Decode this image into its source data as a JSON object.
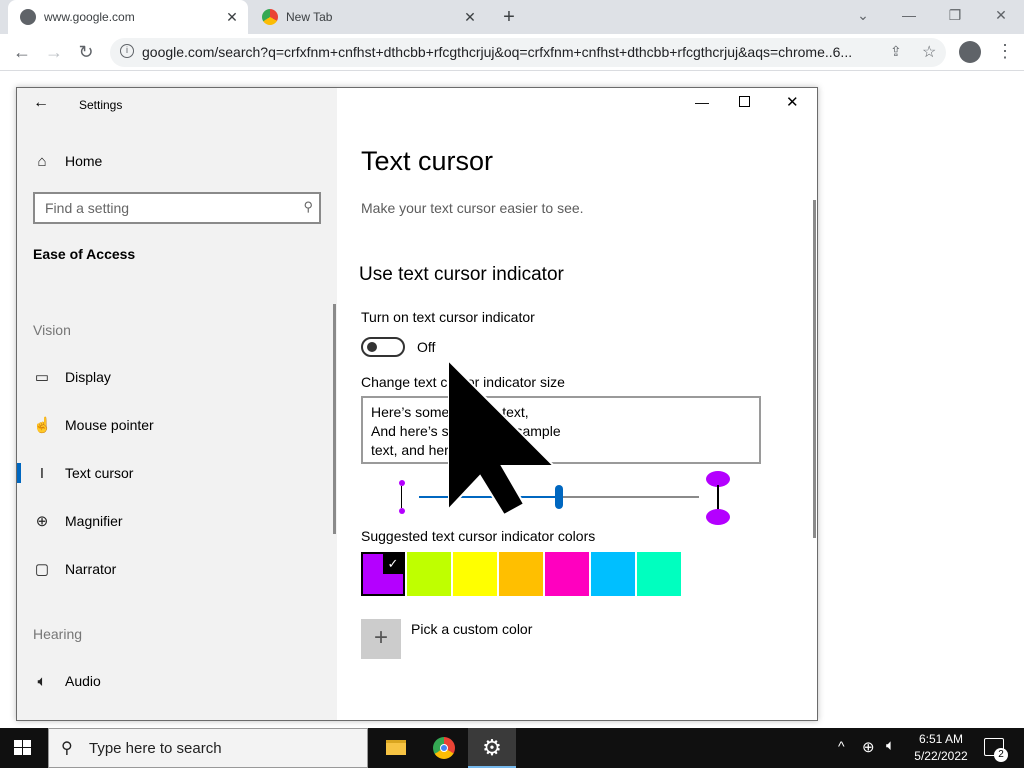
{
  "browser": {
    "tabs": [
      {
        "title": "www.google.com",
        "active": true
      },
      {
        "title": "New Tab",
        "active": false
      }
    ],
    "new_tab_icon": "plus-icon",
    "url": "google.com/search?q=crfxfnm+cnfhst+dthcbb+rfcgthcrjuj&oq=crfxfnm+cnfhst+dthcbb+rfcgthcrjuj&aqs=chrome..6..."
  },
  "settings": {
    "window_title": "Settings",
    "sidebar": {
      "home": "Home",
      "search_placeholder": "Find a setting",
      "category": "Ease of Access",
      "vision_header": "Vision",
      "items": [
        {
          "label": "Display",
          "icon": "display-icon"
        },
        {
          "label": "Mouse pointer",
          "icon": "mouse-pointer-icon"
        },
        {
          "label": "Text cursor",
          "icon": "text-cursor-icon",
          "selected": true
        },
        {
          "label": "Magnifier",
          "icon": "magnifier-icon"
        },
        {
          "label": "Narrator",
          "icon": "narrator-icon"
        }
      ],
      "hearing_header": "Hearing",
      "audio": "Audio"
    },
    "content": {
      "title": "Text cursor",
      "description": "Make your text cursor easier to see.",
      "section": "Use text cursor indicator",
      "toggle_label": "Turn on text cursor indicator",
      "toggle_state": "Off",
      "size_label": "Change text cursor indicator size",
      "sample_lines": [
        "Here’s some sample text,",
        "And here’s some more sample",
        "text, and here’s even more"
      ],
      "size_slider_position": 0.5,
      "colors_label": "Suggested text cursor indicator colors",
      "colors": [
        "#b400ff",
        "#bfff00",
        "#ffff00",
        "#ffbf00",
        "#ff00bf",
        "#00bfff",
        "#00ffbf"
      ],
      "selected_color_index": 0,
      "custom_color_label": "Pick a custom color"
    }
  },
  "taskbar": {
    "search_placeholder": "Type here to search",
    "time": "6:51 AM",
    "date": "5/22/2022",
    "notification_count": "2"
  }
}
